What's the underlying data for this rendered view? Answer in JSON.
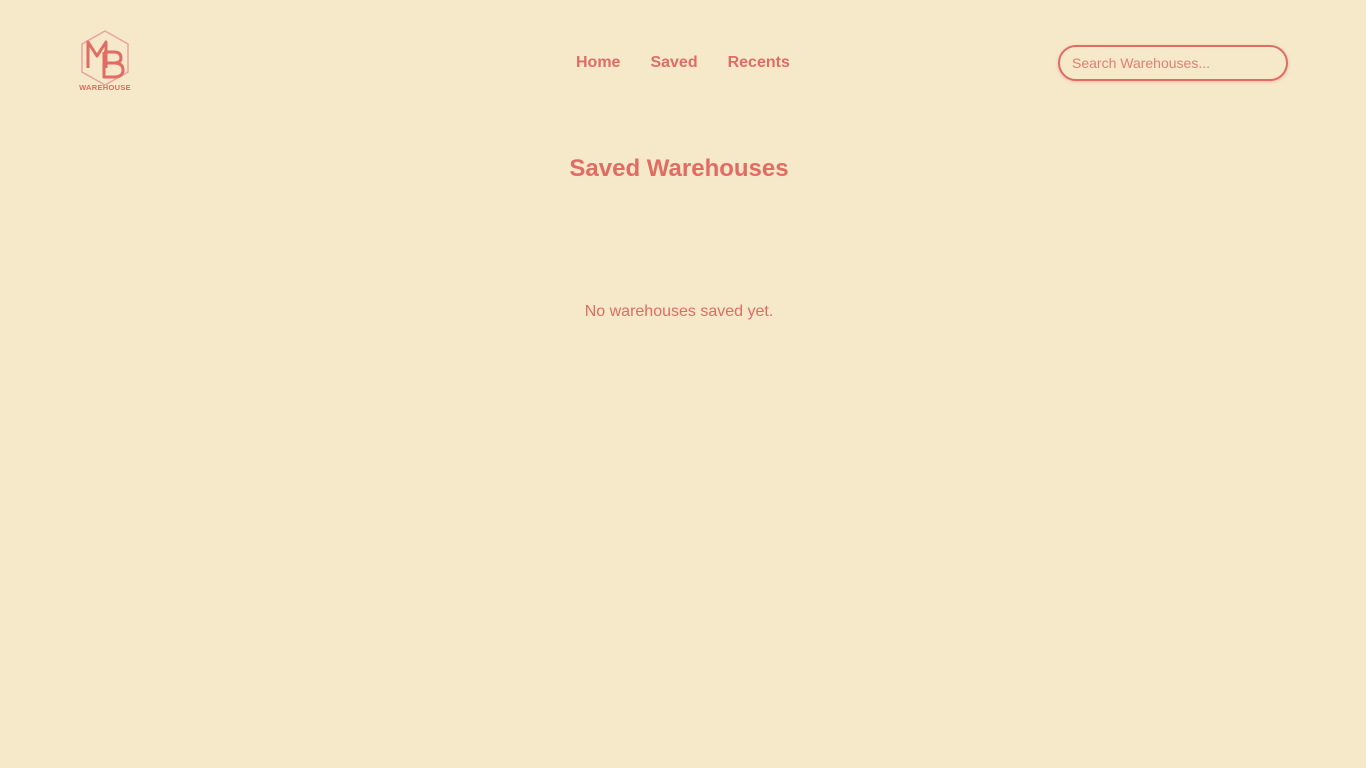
{
  "logo": {
    "monogram": "MB",
    "wordmark": "WAREHOUSE"
  },
  "nav": {
    "items": [
      {
        "label": "Home"
      },
      {
        "label": "Saved"
      },
      {
        "label": "Recents"
      }
    ]
  },
  "search": {
    "placeholder": "Search Warehouses...",
    "value": ""
  },
  "main": {
    "title": "Saved Warehouses",
    "empty_message": "No warehouses saved yet."
  },
  "colors": {
    "background": "#f5e9ca",
    "accent": "#e06c63"
  }
}
